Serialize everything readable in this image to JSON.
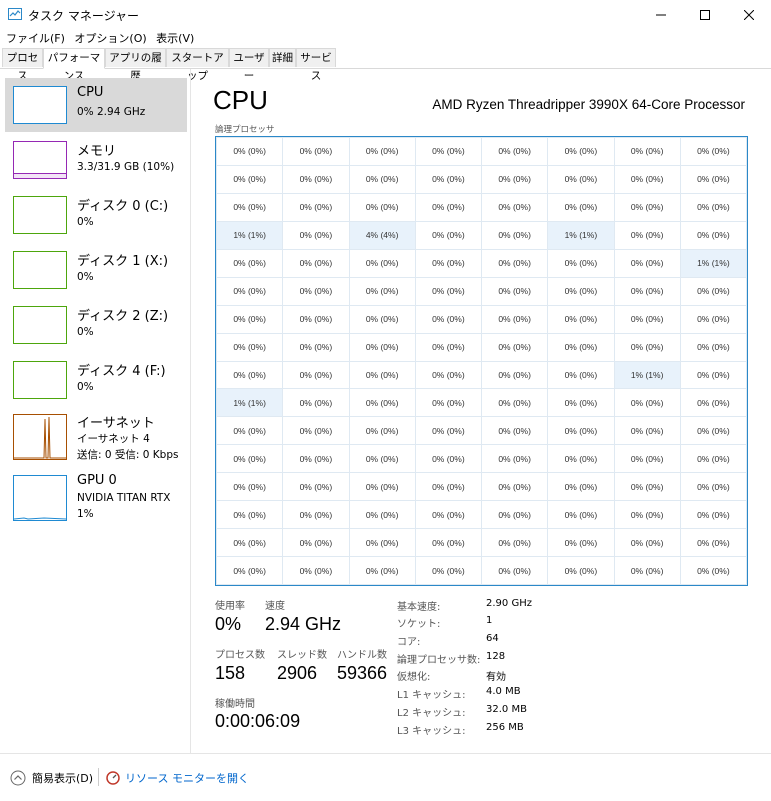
{
  "window": {
    "title": "タスク マネージャー",
    "icon": "task-manager-icon"
  },
  "menu": [
    "ファイル(F)",
    "オプション(O)",
    "表示(V)"
  ],
  "tabs": [
    "プロセス",
    "パフォーマンス",
    "アプリの履歴",
    "スタートアップ",
    "ユーザー",
    "詳細",
    "サービス"
  ],
  "active_tab": "パフォーマンス",
  "sidebar": [
    {
      "name": "CPU",
      "sub1": "0%  2.94 GHz",
      "color": "#1f8ad2"
    },
    {
      "name": "メモリ",
      "sub1": "3.3/31.9 GB (10%)",
      "color": "#9528b4"
    },
    {
      "name": "ディスク 0 (C:)",
      "sub1": "0%",
      "color": "#4da60c"
    },
    {
      "name": "ディスク 1 (X:)",
      "sub1": "0%",
      "color": "#4da60c"
    },
    {
      "name": "ディスク 2 (Z:)",
      "sub1": "0%",
      "color": "#4da60c"
    },
    {
      "name": "ディスク 4 (F:)",
      "sub1": "0%",
      "color": "#4da60c"
    },
    {
      "name": "イーサネット",
      "sub1": "イーサネット 4",
      "sub2": "送信: 0 受信: 0 Kbps",
      "color": "#a74f01"
    },
    {
      "name": "GPU 0",
      "sub1": "NVIDIA TITAN RTX",
      "sub2": "1%",
      "color": "#1f8ad2"
    }
  ],
  "main": {
    "title": "CPU",
    "processor": "AMD Ryzen Threadripper 3990X 64-Core Processor",
    "grid_label": "論理プロセッサ",
    "cores": [
      [
        "0% (0%)",
        "0% (0%)",
        "0% (0%)",
        "0% (0%)",
        "0% (0%)",
        "0% (0%)",
        "0% (0%)",
        "0% (0%)"
      ],
      [
        "0% (0%)",
        "0% (0%)",
        "0% (0%)",
        "0% (0%)",
        "0% (0%)",
        "0% (0%)",
        "0% (0%)",
        "0% (0%)"
      ],
      [
        "0% (0%)",
        "0% (0%)",
        "0% (0%)",
        "0% (0%)",
        "0% (0%)",
        "0% (0%)",
        "0% (0%)",
        "0% (0%)"
      ],
      [
        "1% (1%)",
        "0% (0%)",
        "4% (4%)",
        "0% (0%)",
        "0% (0%)",
        "1% (1%)",
        "0% (0%)",
        "0% (0%)"
      ],
      [
        "0% (0%)",
        "0% (0%)",
        "0% (0%)",
        "0% (0%)",
        "0% (0%)",
        "0% (0%)",
        "0% (0%)",
        "1% (1%)"
      ],
      [
        "0% (0%)",
        "0% (0%)",
        "0% (0%)",
        "0% (0%)",
        "0% (0%)",
        "0% (0%)",
        "0% (0%)",
        "0% (0%)"
      ],
      [
        "0% (0%)",
        "0% (0%)",
        "0% (0%)",
        "0% (0%)",
        "0% (0%)",
        "0% (0%)",
        "0% (0%)",
        "0% (0%)"
      ],
      [
        "0% (0%)",
        "0% (0%)",
        "0% (0%)",
        "0% (0%)",
        "0% (0%)",
        "0% (0%)",
        "0% (0%)",
        "0% (0%)"
      ],
      [
        "0% (0%)",
        "0% (0%)",
        "0% (0%)",
        "0% (0%)",
        "0% (0%)",
        "0% (0%)",
        "1% (1%)",
        "0% (0%)"
      ],
      [
        "1% (1%)",
        "0% (0%)",
        "0% (0%)",
        "0% (0%)",
        "0% (0%)",
        "0% (0%)",
        "0% (0%)",
        "0% (0%)"
      ],
      [
        "0% (0%)",
        "0% (0%)",
        "0% (0%)",
        "0% (0%)",
        "0% (0%)",
        "0% (0%)",
        "0% (0%)",
        "0% (0%)"
      ],
      [
        "0% (0%)",
        "0% (0%)",
        "0% (0%)",
        "0% (0%)",
        "0% (0%)",
        "0% (0%)",
        "0% (0%)",
        "0% (0%)"
      ],
      [
        "0% (0%)",
        "0% (0%)",
        "0% (0%)",
        "0% (0%)",
        "0% (0%)",
        "0% (0%)",
        "0% (0%)",
        "0% (0%)"
      ],
      [
        "0% (0%)",
        "0% (0%)",
        "0% (0%)",
        "0% (0%)",
        "0% (0%)",
        "0% (0%)",
        "0% (0%)",
        "0% (0%)"
      ],
      [
        "0% (0%)",
        "0% (0%)",
        "0% (0%)",
        "0% (0%)",
        "0% (0%)",
        "0% (0%)",
        "0% (0%)",
        "0% (0%)"
      ],
      [
        "0% (0%)",
        "0% (0%)",
        "0% (0%)",
        "0% (0%)",
        "0% (0%)",
        "0% (0%)",
        "0% (0%)",
        "0% (0%)"
      ]
    ],
    "stats": {
      "usage_label": "使用率",
      "usage": "0%",
      "speed_label": "速度",
      "speed": "2.94 GHz",
      "processes_label": "プロセス数",
      "processes": "158",
      "threads_label": "スレッド数",
      "threads": "2906",
      "handles_label": "ハンドル数",
      "handles": "59366",
      "uptime_label": "稼働時間",
      "uptime": "0:00:06:09"
    },
    "info": [
      {
        "label": "基本速度:",
        "value": "2.90 GHz"
      },
      {
        "label": "ソケット:",
        "value": "1"
      },
      {
        "label": "コア:",
        "value": "64"
      },
      {
        "label": "論理プロセッサ数:",
        "value": "128"
      },
      {
        "label": "仮想化:",
        "value": "有効"
      },
      {
        "label": "L1 キャッシュ:",
        "value": "4.0 MB"
      },
      {
        "label": "L2 キャッシュ:",
        "value": "32.0 MB"
      },
      {
        "label": "L3 キャッシュ:",
        "value": "256 MB"
      }
    ]
  },
  "footer": {
    "fewer_details": "簡易表示(D)",
    "resource_monitor": "リソース モニターを開く"
  }
}
